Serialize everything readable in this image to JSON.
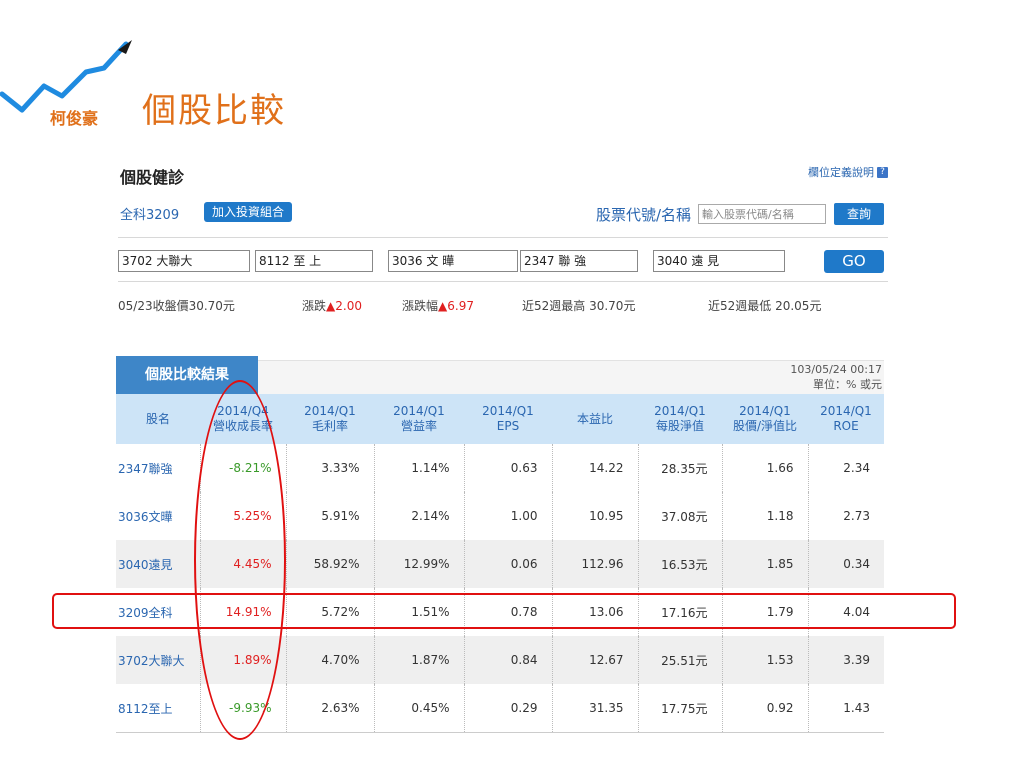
{
  "slide": {
    "author": "柯俊豪",
    "title": "個股比較"
  },
  "panel": {
    "title": "個股健診",
    "help_link": "欄位定義說明",
    "stock_name": "全科3209",
    "add_button": "加入投資組合",
    "code_label": "股票代號/名稱",
    "code_placeholder": "輸入股票代碼/名稱",
    "query_button": "查詢",
    "compare_inputs": [
      "3702 大聯大",
      "8112 至 上",
      "3036 文 曄",
      "2347 聯 強",
      "3040 遠 見"
    ],
    "go_button": "GO",
    "quote": {
      "close_label": "05/23收盤價30.70元",
      "change_label": "漲跌",
      "change_value": "▲2.00",
      "pct_label": "漲跌幅",
      "pct_value": "▲6.97",
      "high52": "近52週最高 30.70元",
      "low52": "近52週最低 20.05元"
    }
  },
  "result": {
    "tab_label": "個股比較結果",
    "timestamp": "103/05/24 00:17",
    "unit": "單位：% 或元",
    "headers": [
      [
        "股名",
        ""
      ],
      [
        "2014/Q4",
        "營收成長率"
      ],
      [
        "2014/Q1",
        "毛利率"
      ],
      [
        "2014/Q1",
        "營益率"
      ],
      [
        "2014/Q1",
        "EPS"
      ],
      [
        "本益比",
        ""
      ],
      [
        "2014/Q1",
        "每股淨值"
      ],
      [
        "2014/Q1",
        "股價/淨值比"
      ],
      [
        "2014/Q1",
        "ROE"
      ]
    ],
    "rows": [
      [
        "2347聯強",
        "-8.21%",
        "3.33%",
        "1.14%",
        "0.63",
        "14.22",
        "28.35元",
        "1.66",
        "2.34"
      ],
      [
        "3036文曄",
        "5.25%",
        "5.91%",
        "2.14%",
        "1.00",
        "10.95",
        "37.08元",
        "1.18",
        "2.73"
      ],
      [
        "3040遠見",
        "4.45%",
        "58.92%",
        "12.99%",
        "0.06",
        "112.96",
        "16.53元",
        "1.85",
        "0.34"
      ],
      [
        "3209全科",
        "14.91%",
        "5.72%",
        "1.51%",
        "0.78",
        "13.06",
        "17.16元",
        "1.79",
        "4.04"
      ],
      [
        "3702大聯大",
        "1.89%",
        "4.70%",
        "1.87%",
        "0.84",
        "12.67",
        "25.51元",
        "1.53",
        "3.39"
      ],
      [
        "8112至上",
        "-9.93%",
        "2.63%",
        "0.45%",
        "0.29",
        "31.35",
        "17.75元",
        "0.92",
        "1.43"
      ]
    ]
  },
  "colors": {
    "accent": "#e0701a",
    "blue": "#1f79c9",
    "positive": "#e02020",
    "negative": "#3a9a2a",
    "annotation": "#e01010"
  }
}
